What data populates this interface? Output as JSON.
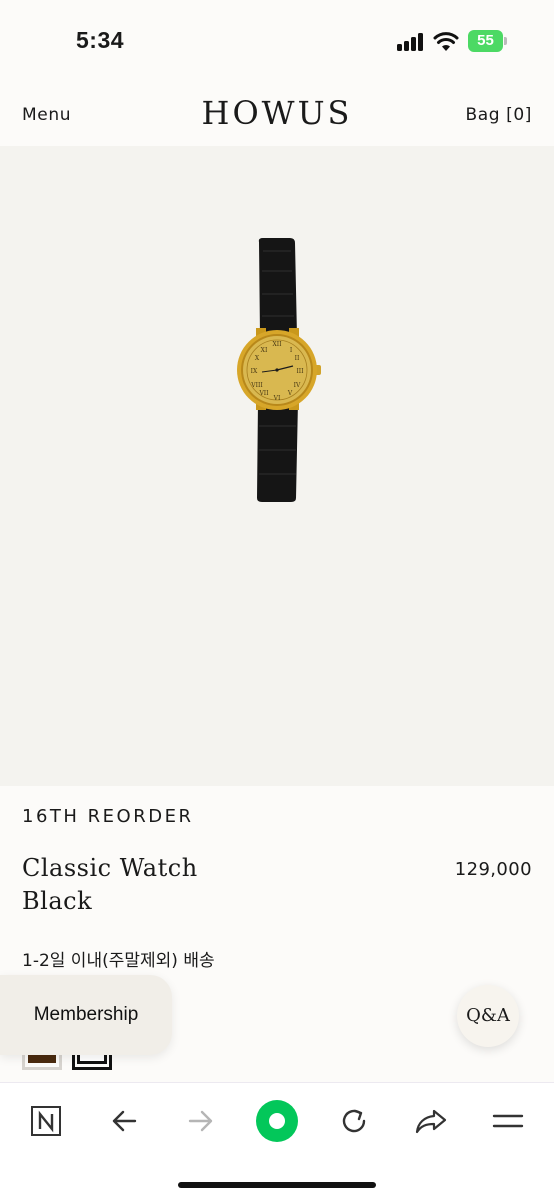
{
  "status_bar": {
    "time": "5:34",
    "battery": "55"
  },
  "header": {
    "menu_label": "Menu",
    "brand": "HOWUS",
    "bag_label": "Bag [0]"
  },
  "product": {
    "tag": "16TH REORDER",
    "name_line1": "Classic Watch",
    "name_line2": "Black",
    "price": "129,000",
    "shipping_note": "1-2일 이내(주말제외) 배송",
    "color_swatches": [
      "brown",
      "black"
    ]
  },
  "floating": {
    "membership_label": "Membership",
    "qna_label": "Q&A"
  },
  "toolbar": {
    "icons": [
      "naver-n-icon",
      "back-arrow-icon",
      "forward-arrow-icon",
      "green-record-icon",
      "refresh-icon",
      "share-icon",
      "menu-icon"
    ]
  },
  "colors": {
    "background": "#fcfbf9",
    "image_bg": "#f4f3ef",
    "accent_green": "#03c75a",
    "battery_green": "#4cd964"
  }
}
